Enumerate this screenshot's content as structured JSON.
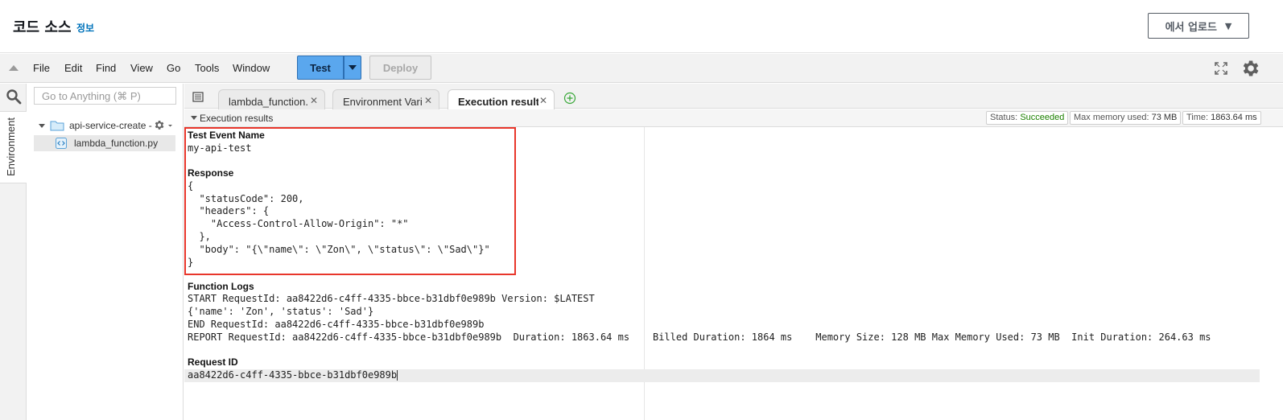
{
  "header": {
    "title": "코드 소스",
    "info_link": "정보",
    "upload_button": "에서 업로드"
  },
  "menubar": {
    "items": [
      "File",
      "Edit",
      "Find",
      "View",
      "Go",
      "Tools",
      "Window"
    ],
    "test_button": "Test",
    "deploy_button": "Deploy"
  },
  "left_rail": {
    "environment_tab": "Environment"
  },
  "file_panel": {
    "search_placeholder": "Go to Anything (⌘ P)",
    "folder": "api-service-create -",
    "file": "lambda_function.py"
  },
  "tabs": [
    {
      "label": "lambda_function.",
      "active": false
    },
    {
      "label": "Environment Vari",
      "active": false
    },
    {
      "label": "Execution results",
      "active": true
    }
  ],
  "execution": {
    "title": "Execution results",
    "status_label": "Status:",
    "status_value": "Succeeded",
    "memory_label": "Max memory used:",
    "memory_value": "73 MB",
    "time_label": "Time:",
    "time_value": "1863.64 ms"
  },
  "results": {
    "test_event_heading": "Test Event Name",
    "test_event_name": "my-api-test",
    "response_heading": "Response",
    "response_lines": [
      "{",
      "  \"statusCode\": 200,",
      "  \"headers\": {",
      "    \"Access-Control-Allow-Origin\": \"*\"",
      "  },",
      "  \"body\": \"{\\\"name\\\": \\\"Zon\\\", \\\"status\\\": \\\"Sad\\\"}\"",
      "}"
    ],
    "logs_heading": "Function Logs",
    "log_lines": [
      "START RequestId: aa8422d6-c4ff-4335-bbce-b31dbf0e989b Version: $LATEST",
      "{'name': 'Zon', 'status': 'Sad'}",
      "END RequestId: aa8422d6-c4ff-4335-bbce-b31dbf0e989b",
      "REPORT RequestId: aa8422d6-c4ff-4335-bbce-b31dbf0e989b  Duration: 1863.64 ms    Billed Duration: 1864 ms    Memory Size: 128 MB Max Memory Used: 73 MB  Init Duration: 264.63 ms"
    ],
    "request_id_heading": "Request ID",
    "request_id": "aa8422d6-c4ff-4335-bbce-b31dbf0e989b"
  },
  "colors": {
    "accent": "#0073bb",
    "test_button": "#5aa7ee",
    "success": "#1d8102",
    "highlight_border": "#e8362b"
  },
  "icons": [
    "collapse-arrow-icon",
    "fullscreen-icon",
    "gear-icon",
    "search-icon",
    "folder-icon",
    "code-file-icon",
    "tabs-menu-icon",
    "close-icon",
    "add-tab-icon"
  ]
}
